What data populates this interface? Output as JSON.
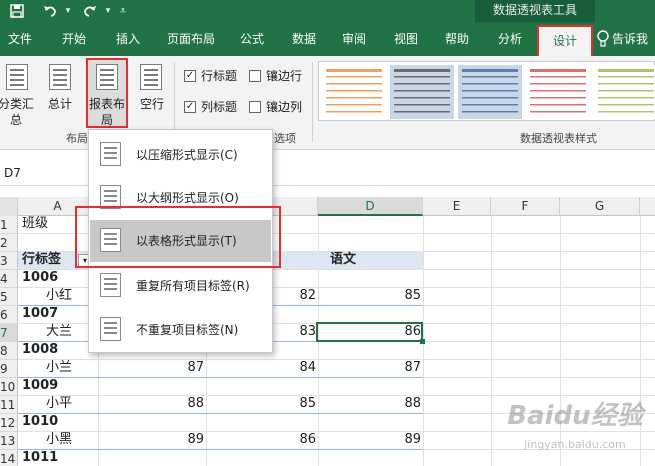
{
  "window": {
    "context_title": "数据透视表工具"
  },
  "quick_access": {
    "save_icon": "save-icon",
    "undo_icon": "undo-icon",
    "redo_icon": "redo-icon",
    "customize_icon": "customize-qat-icon"
  },
  "tabs": [
    "文件",
    "开始",
    "插入",
    "页面布局",
    "公式",
    "数据",
    "审阅",
    "视图",
    "帮助",
    "分析",
    "设计"
  ],
  "active_tab": "设计",
  "tell_me": "告诉我",
  "ribbon": {
    "subtotal_label": "分类汇总",
    "grand_total_label": "总计",
    "report_layout_label": "报表布局",
    "blank_rows_label": "空行",
    "layout_group_label": "布局",
    "options": {
      "row_headers": "行标题",
      "banded_rows": "镶边行",
      "column_headers": "列标题",
      "banded_columns": "镶边列",
      "group_label": "选项"
    },
    "styles_group_label": "数据透视表样式",
    "style_swatch_colors": [
      "#f0a060",
      "#6a6a6a",
      "#5b7fb0",
      "#e07070",
      "#a8c870"
    ]
  },
  "name_box": "D7",
  "columns": [
    "A",
    "B",
    "C",
    "D",
    "E",
    "F",
    "G"
  ],
  "rows": [
    "1",
    "2",
    "3",
    "4",
    "5",
    "6",
    "7",
    "8",
    "9",
    "10",
    "11",
    "12",
    "13",
    "14"
  ],
  "cells": {
    "a1": "班级",
    "a3": "行标签",
    "d3": "语文",
    "rows_data": [
      {
        "id": "1006",
        "name": "小红",
        "b": "",
        "c": "82",
        "d": "85"
      },
      {
        "id": "1007",
        "name": "大兰",
        "b": "",
        "c": "83",
        "d": "86"
      },
      {
        "id": "1008",
        "name": "小兰",
        "b": "87",
        "c": "84",
        "d": "87"
      },
      {
        "id": "1009",
        "name": "小平",
        "b": "88",
        "c": "85",
        "d": "88"
      },
      {
        "id": "1010",
        "name": "小黑",
        "b": "89",
        "c": "86",
        "d": "89"
      }
    ],
    "row14_id": "1011"
  },
  "menu": {
    "items": [
      "以压缩形式显示(C)",
      "以大纲形式显示(O)",
      "以表格形式显示(T)",
      "重复所有项目标签(R)",
      "不重复项目标签(N)"
    ],
    "highlighted_index": 2
  },
  "watermark": {
    "logo": "Baidu经验",
    "url": "jingyan.baidu.com"
  },
  "colors": {
    "excel_green": "#217346",
    "highlight_red": "#e03030"
  }
}
